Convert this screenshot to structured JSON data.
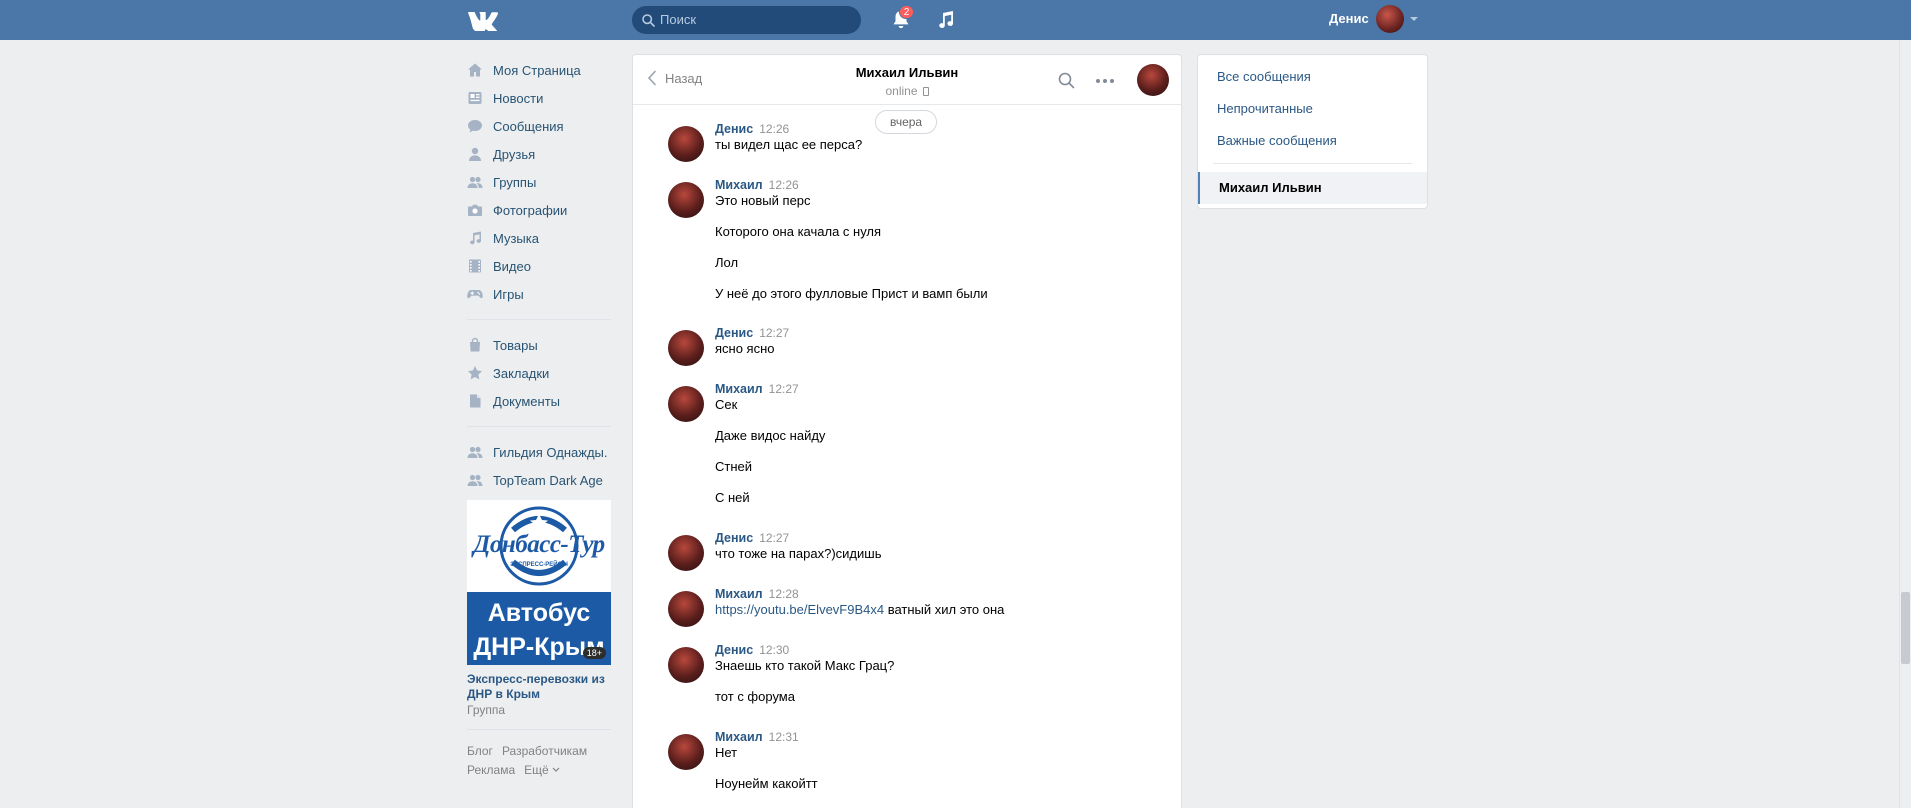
{
  "header": {
    "logo_icon": "vk-logo-icon",
    "search_placeholder": "Поиск",
    "notifications_count": "2",
    "user_name": "Денис"
  },
  "sidebar": {
    "items": [
      {
        "label": "Моя Страница",
        "icon": "home-icon"
      },
      {
        "label": "Новости",
        "icon": "news-icon"
      },
      {
        "label": "Сообщения",
        "icon": "messages-icon"
      },
      {
        "label": "Друзья",
        "icon": "friends-icon"
      },
      {
        "label": "Группы",
        "icon": "groups-icon"
      },
      {
        "label": "Фотографии",
        "icon": "camera-icon"
      },
      {
        "label": "Музыка",
        "icon": "music-icon"
      },
      {
        "label": "Видео",
        "icon": "video-icon"
      },
      {
        "label": "Игры",
        "icon": "gamepad-icon"
      },
      {
        "label": "Товары",
        "icon": "bag-icon"
      },
      {
        "label": "Закладки",
        "icon": "star-icon"
      },
      {
        "label": "Документы",
        "icon": "document-icon"
      },
      {
        "label": "Гильдия Однажды.",
        "icon": "group-icon"
      },
      {
        "label": "TopTeam Dark Age",
        "icon": "group-icon"
      }
    ]
  },
  "ad": {
    "logo_text": "Донбасс-Тур",
    "logo_subtext": "ЭКСПРЕСС-РЕЙСЫ",
    "banner_text_1": "Автобус",
    "banner_text_2": "ДНР-Крым",
    "age_badge": "18+",
    "title": "Экспресс-перевозки из ДНР в Крым",
    "subtitle": "Группа"
  },
  "footer": {
    "links": [
      "Блог",
      "Разработчикам",
      "Реклама",
      "Ещё"
    ]
  },
  "chat": {
    "back_label": "Назад",
    "peer_name": "Михаил Ильвин",
    "peer_status": "online",
    "day_label": "вчера",
    "messages": [
      {
        "author": "Денис",
        "time": "12:26",
        "lines": [
          "ты видел щас ее перса?"
        ]
      },
      {
        "author": "Михаил",
        "time": "12:26",
        "lines": [
          "Это новый перс",
          "Которого она качала с нуля",
          "Лол",
          "У неё до этого фулловые Прист и вамп были"
        ]
      },
      {
        "author": "Денис",
        "time": "12:27",
        "lines": [
          "ясно ясно"
        ]
      },
      {
        "author": "Михаил",
        "time": "12:27",
        "lines": [
          "Сек",
          "Даже видос найду",
          "Стней",
          "С ней"
        ]
      },
      {
        "author": "Денис",
        "time": "12:27",
        "lines": [
          "что тоже на парах?)сидишь"
        ]
      },
      {
        "author": "Михаил",
        "time": "12:28",
        "link": "https://youtu.be/ElvevF9B4x4",
        "link_suffix": " ватный хил это она"
      },
      {
        "author": "Денис",
        "time": "12:30",
        "lines": [
          "Знаешь кто такой Макс Грац?",
          "тот с форума"
        ]
      },
      {
        "author": "Михаил",
        "time": "12:31",
        "lines": [
          "Нет",
          "Ноунейм какойтт"
        ]
      }
    ]
  },
  "right_panel": {
    "items": [
      "Все сообщения",
      "Непрочитанные",
      "Важные сообщения"
    ],
    "active": "Михаил Ильвин"
  },
  "colors": {
    "header_bg": "#4a76a8",
    "link": "#2a5885",
    "page_bg": "#edeef0"
  }
}
